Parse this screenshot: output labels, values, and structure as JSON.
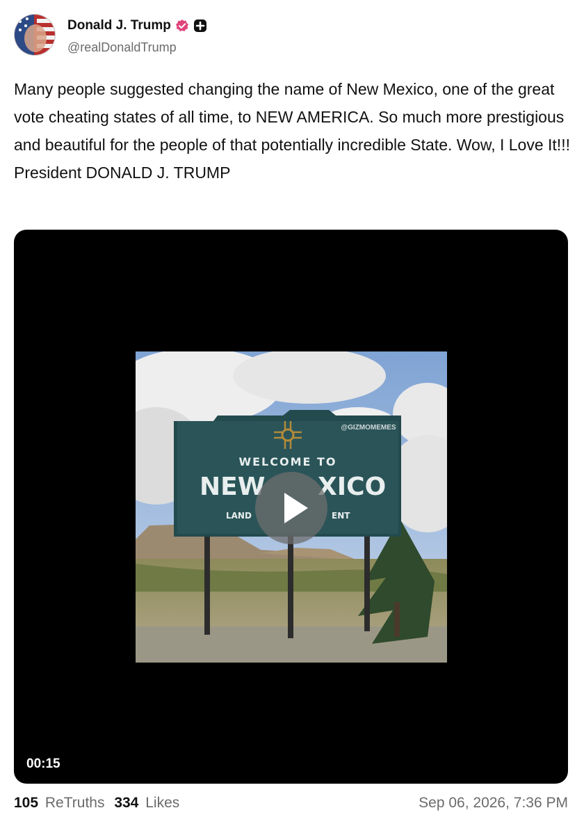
{
  "author": {
    "display_name": "Donald J. Trump",
    "handle": "@realDonaldTrump",
    "verified_color": "#e0457b"
  },
  "post": {
    "text": "Many people suggested changing the name of New Mexico, one of the great vote cheating states of all time, to NEW AMERICA. So much more prestigious and beautiful for the people of that potentially incredible State. Wow, I Love It!!! President DONALD J. TRUMP"
  },
  "video": {
    "duration": "00:15",
    "thumbnail": {
      "watermark": "@GIZMOMEMES",
      "sign_line1": "WELCOME TO",
      "sign_line2_left": "NEW",
      "sign_line2_right": "XICO",
      "sign_line3_left": "LAND",
      "sign_line3_right": "ENT"
    }
  },
  "stats": {
    "retruths_count": "105",
    "retruths_label": "ReTruths",
    "likes_count": "334",
    "likes_label": "Likes",
    "timestamp": "Sep 06, 2026, 7:36 PM"
  }
}
